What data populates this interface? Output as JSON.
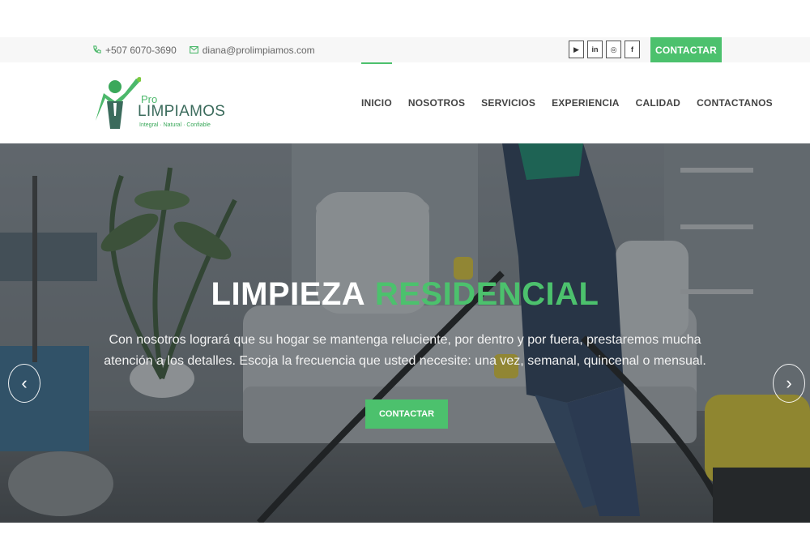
{
  "topbar": {
    "phone_icon": "phone-icon",
    "phone": "+507 6070-3690",
    "email_icon": "mail-icon",
    "email": "diana@prolimpiamos.com",
    "social": [
      {
        "name": "youtube-icon",
        "glyph": "▶"
      },
      {
        "name": "linkedin-icon",
        "glyph": "in"
      },
      {
        "name": "instagram-icon",
        "glyph": "◎"
      },
      {
        "name": "facebook-icon",
        "glyph": "f"
      }
    ],
    "cta_label": "CONTACTAR"
  },
  "logo": {
    "pro": "Pro",
    "main": "LIMPIAMOS",
    "tagline": "Integral · Natural · Confiable"
  },
  "nav": {
    "items": [
      {
        "label": "INICIO",
        "active": true
      },
      {
        "label": "NOSOTROS",
        "active": false
      },
      {
        "label": "SERVICIOS",
        "active": false
      },
      {
        "label": "EXPERIENCIA",
        "active": false
      },
      {
        "label": "CALIDAD",
        "active": false
      },
      {
        "label": "CONTACTANOS",
        "active": false
      }
    ]
  },
  "hero": {
    "title_plain": "LIMPIEZA",
    "title_accent": "RESIDENCIAL",
    "description": "Con nosotros logrará que su hogar se mantenga reluciente, por dentro y por fuera, prestaremos mucha atención a los detalles. Escoja la frecuencia que usted necesite: una vez, semanal, quincenal o mensual.",
    "cta_label": "CONTACTAR",
    "prev_glyph": "‹",
    "next_glyph": "›"
  },
  "colors": {
    "accent": "#4cc16d",
    "text_dark": "#444444"
  }
}
